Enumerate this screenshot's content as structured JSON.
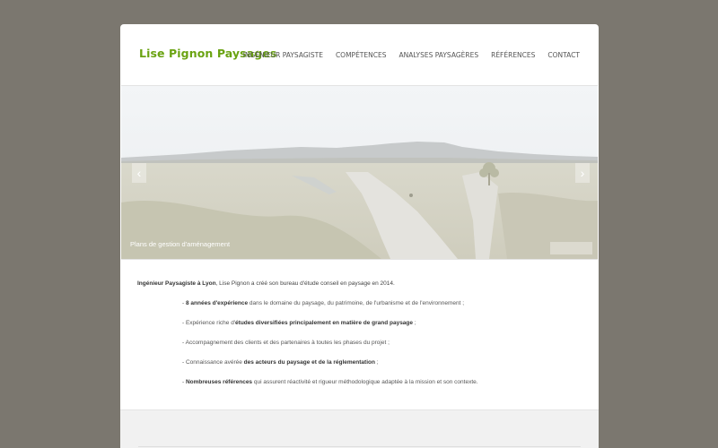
{
  "site": {
    "title": "Lise Pignon Paysages"
  },
  "nav": {
    "items": [
      {
        "label": "INGÉNIEUR PAYSAGISTE"
      },
      {
        "label": "COMPÉTENCES"
      },
      {
        "label": "ANALYSES PAYSAGÈRES"
      },
      {
        "label": "RÉFÉRENCES"
      },
      {
        "label": "CONTACT"
      }
    ]
  },
  "slider": {
    "caption": "Plans de gestion d'aménagement",
    "prev_icon": "chevron-left-icon",
    "next_icon": "chevron-right-icon",
    "prev_glyph": "‹",
    "next_glyph": "›"
  },
  "content": {
    "intro": {
      "strong": "Ingénieur Paysagiste à Lyon",
      "rest": ", Lise Pignon a créé son bureau d'étude conseil en paysage en 2014."
    },
    "bullets": [
      {
        "pre": "- ",
        "strong": "8 années d'expérience",
        "post": " dans le domaine du paysage, du patrimoine, de l'urbanisme et de l'environnement ;"
      },
      {
        "pre": "- Expérience riche d'",
        "strong": "études diversifiées principalement en matière de grand paysage",
        "post": " ;"
      },
      {
        "pre": "- Accompagnement des clients et des partenaires à toutes les phases du projet ;",
        "strong": "",
        "post": ""
      },
      {
        "pre": "- Connaissance avérée ",
        "strong": "des acteurs du paysage et de la réglementation",
        "post": " ;"
      },
      {
        "pre": "- ",
        "strong": "Nombreuses références",
        "post": " qui assurent réactivité et rigueur méthodologique adaptée à la mission et son contexte."
      }
    ]
  },
  "colors": {
    "background": "#7b776f",
    "brand": "#6aa312",
    "page": "#ffffff"
  }
}
